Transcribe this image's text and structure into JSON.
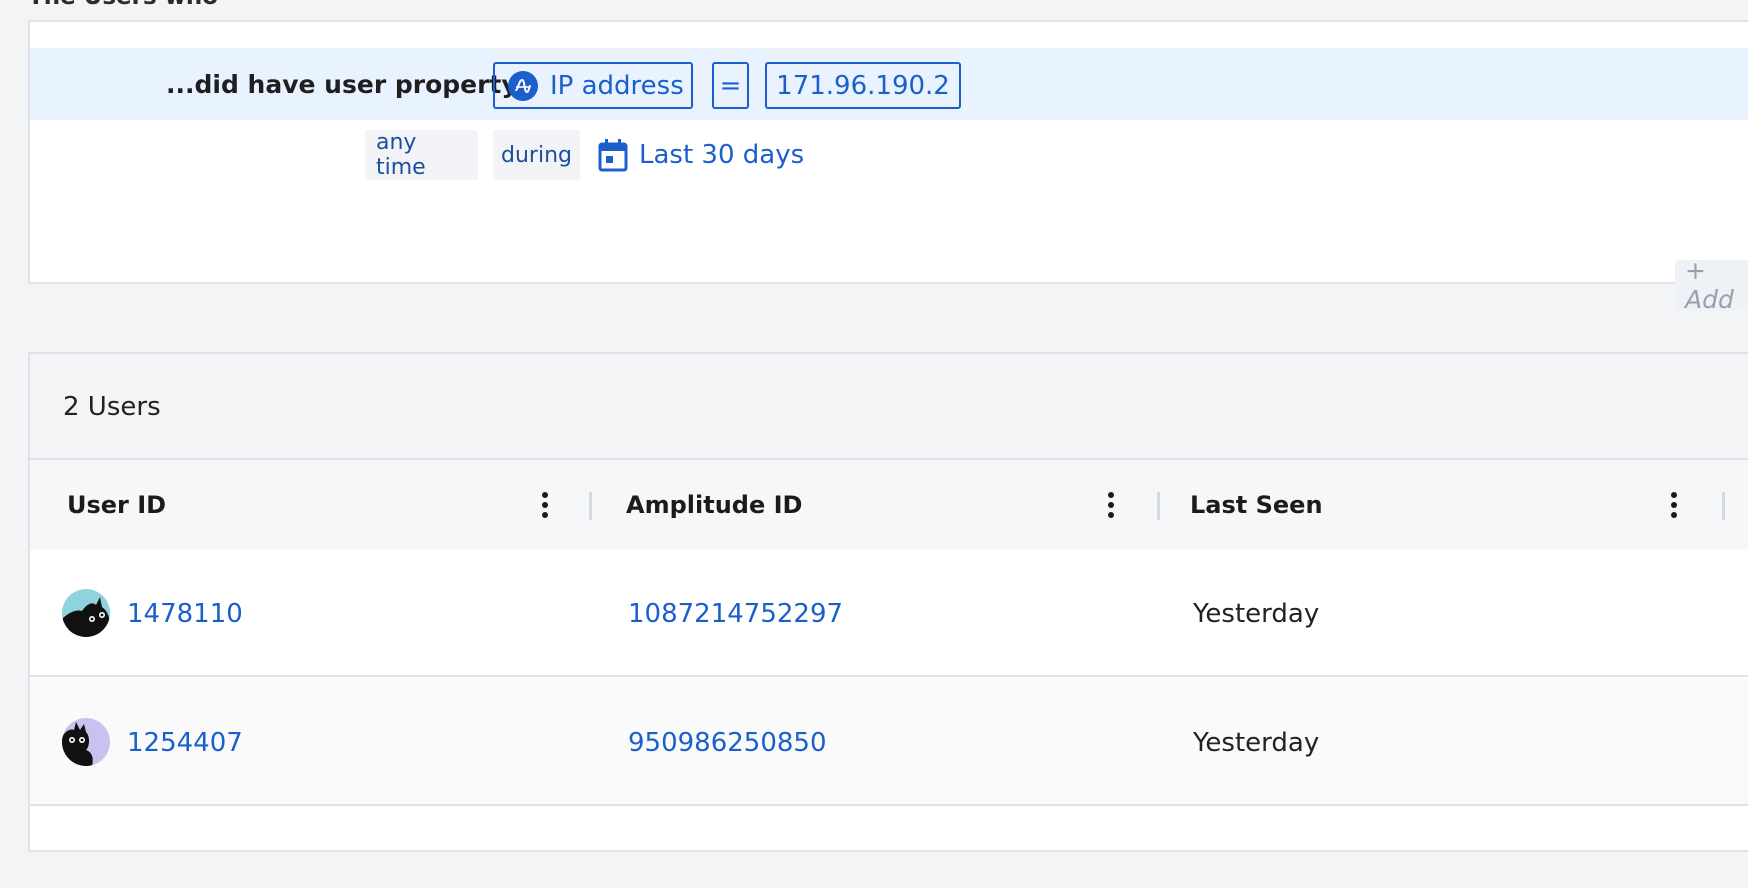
{
  "segment": {
    "heading": "The Users who",
    "condition": {
      "label": "...did have user property",
      "property": "IP address",
      "operator": "=",
      "value": "171.96.190.2"
    },
    "time": {
      "frequency": "any time",
      "qualifier": "during",
      "range": "Last 30 days"
    },
    "add_label": "+ Add"
  },
  "results": {
    "count_label": "2 Users",
    "columns": [
      "User ID",
      "Amplitude ID",
      "Last Seen"
    ],
    "rows": [
      {
        "user_id": "1478110",
        "amplitude_id": "1087214752297",
        "last_seen": "Yesterday",
        "avatar_bg": "#8fd3dc"
      },
      {
        "user_id": "1254407",
        "amplitude_id": "950986250850",
        "last_seen": "Yesterday",
        "avatar_bg": "#c9c2f0"
      }
    ]
  },
  "colors": {
    "link": "#1b5fcc",
    "highlight_row": "#e8f3ff"
  }
}
